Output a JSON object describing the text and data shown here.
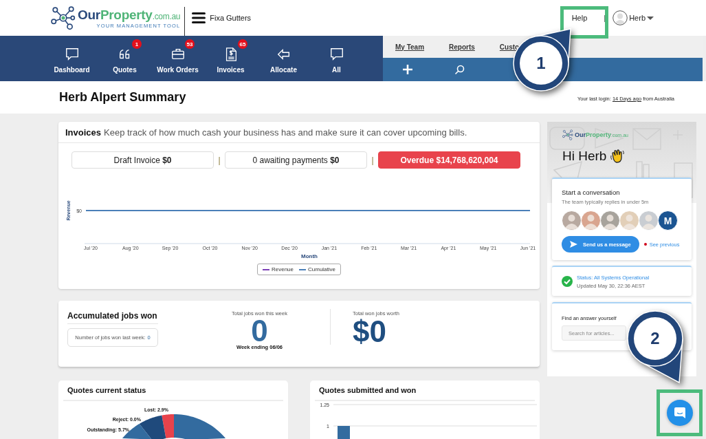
{
  "header": {
    "logo": {
      "brand": "Our",
      "brand_accent": "Property",
      "domain": ".com.au",
      "tagline": "YOUR MANAGEMENT TOOL"
    },
    "business": "Fixa Gutters",
    "help": "Help",
    "separator": "|",
    "user": "Herb"
  },
  "nav": [
    {
      "label": "Dashboard"
    },
    {
      "label": "Quotes",
      "badge": "1"
    },
    {
      "label": "Work Orders",
      "badge": "53"
    },
    {
      "label": "Invoices",
      "badge": "65"
    },
    {
      "label": "Allocate"
    },
    {
      "label": "All"
    }
  ],
  "links": [
    "My Team",
    "Reports",
    "Custo"
  ],
  "summary": {
    "title": "Herb Alpert Summary",
    "login_prefix": "Your last login:",
    "login_link": "14 Days ago",
    "login_suffix": "from Australia"
  },
  "invoices": {
    "title": "Invoices",
    "description": "Keep track of how much cash your business has and make sure it can cover upcoming bills.",
    "pills": [
      {
        "kind": "outline",
        "text": "Draft Invoice **$0**"
      },
      {
        "kind": "outline",
        "text": "0 awaiting payments **$0**"
      },
      {
        "kind": "alert",
        "text": "Overdue $14,768,620,004"
      }
    ],
    "separators": [
      "|",
      "|"
    ],
    "chart": {
      "xlabel": "Month",
      "ylabel": "Revenue",
      "y_tick": "$0",
      "months": [
        "Jul '20",
        "Aug '20",
        "Sep '20",
        "Oct '20",
        "Nov '20",
        "Dec '20",
        "Jan '21",
        "Feb '21",
        "Mar '21",
        "Apr '21",
        "May '21",
        "Jun '21"
      ],
      "legend": [
        {
          "name": "Revenue",
          "color": "#7b3fb5"
        },
        {
          "name": "Cumulative",
          "color": "#4a7fb8"
        }
      ]
    }
  },
  "jobs": {
    "title": "Accumulated jobs won",
    "last_week_label": "Number of jobs won last week:",
    "last_week_value": "0",
    "week_label": "Total jobs won this week",
    "week_value": "0",
    "week_ending": "Week ending 06/06",
    "worth_label": "Total won jobs worth",
    "worth_value": "$0"
  },
  "quotes_status": {
    "title": "Quotes current status",
    "slice_labels": [
      "Lost: 2.9%",
      "Reject: 0.0%",
      "Outstanding: 5.7%"
    ]
  },
  "quotes_won": {
    "title": "Quotes submitted and won",
    "y_ticks": [
      "1.25",
      "1"
    ]
  },
  "chat": {
    "brand": "Our",
    "brand_accent": "Property",
    "domain": ".com.au",
    "greeting": "Hi Herb",
    "conversation": {
      "title": "Start a conversation",
      "subtitle": "The team typically replies in under 5m",
      "avatars": [
        {
          "kind": "picture"
        },
        {
          "kind": "picture"
        },
        {
          "kind": "picture"
        },
        {
          "kind": "picture"
        },
        {
          "kind": "picture"
        },
        {
          "kind": "initial",
          "initial": "M"
        }
      ],
      "button": "Send us a message",
      "link": "See previous"
    },
    "status": {
      "title": "Status: All Systems Operational",
      "updated": "Updated May 30, 22:36 AEST"
    },
    "search": {
      "title": "Find an answer yourself",
      "placeholder": "Search for articles..."
    }
  },
  "annotations": [
    {
      "number": "1"
    },
    {
      "number": "2"
    }
  ]
}
